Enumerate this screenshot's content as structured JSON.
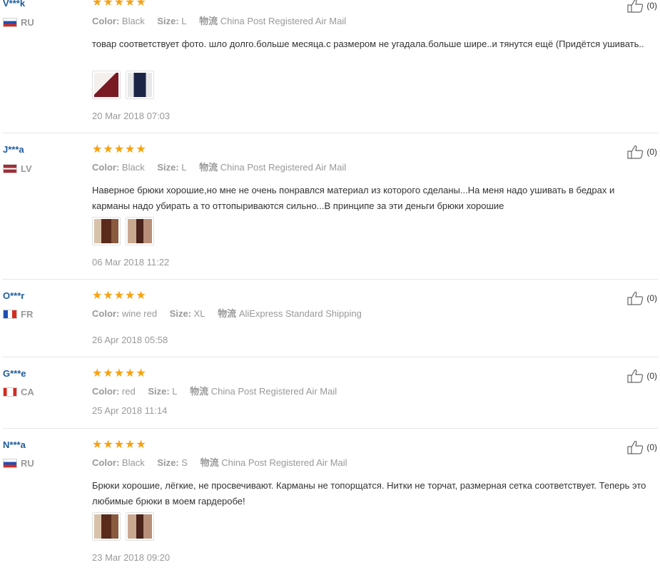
{
  "rating_star": "★★★★★",
  "thumb_colors": {
    "white_wine": [
      "#f3f0ee",
      "#7a1a22"
    ],
    "navy": [
      "#1c2545",
      "#2f3d72"
    ],
    "brown_a": [
      "#5a2a1d",
      "#d9c2aa"
    ],
    "brown_b": [
      "#4a231a",
      "#c9a890"
    ]
  },
  "reviews": [
    {
      "name": "V***k",
      "country": "RU",
      "flag": "ru",
      "color_label": "Color:",
      "color": "Black",
      "size_label": "Size:",
      "size": "L",
      "ship_label": "物流",
      "ship": "China Post Registered Air Mail",
      "text": "товар соответствует фото. шло долго.больше месяца.с размером не угадала.больше шире..и тянутся ещё (Придётся ушивать..",
      "date": "20 Mar 2018 07:03",
      "likes": "(0)"
    },
    {
      "name": "J***a",
      "country": "LV",
      "flag": "lv",
      "color_label": "Color:",
      "color": "Black",
      "size_label": "Size:",
      "size": "L",
      "ship_label": "物流",
      "ship": "China Post Registered Air Mail",
      "text": "Наверное брюки хорошие,но мне не очень понравлся материал из которого сделаны...На меня надо ушивать в бедрах и карманы надо убирать а то оттопыриваются сильно...В принципе за эти деньги брюки хорошие",
      "date": "06 Mar 2018 11:22",
      "likes": "(0)"
    },
    {
      "name": "O***r",
      "country": "FR",
      "flag": "fr",
      "color_label": "Color:",
      "color": "wine red",
      "size_label": "Size:",
      "size": "XL",
      "ship_label": "物流",
      "ship": "AliExpress Standard Shipping",
      "text": "",
      "date": "26 Apr 2018 05:58",
      "likes": "(0)"
    },
    {
      "name": "G***e",
      "country": "CA",
      "flag": "ca",
      "color_label": "Color:",
      "color": "red",
      "size_label": "Size:",
      "size": "L",
      "ship_label": "物流",
      "ship": "China Post Registered Air Mail",
      "text": "",
      "date": "25 Apr 2018 11:14",
      "likes": "(0)"
    },
    {
      "name": "N***a",
      "country": "RU",
      "flag": "ru",
      "color_label": "Color:",
      "color": "Black",
      "size_label": "Size:",
      "size": "S",
      "ship_label": "物流",
      "ship": "China Post Registered Air Mail",
      "text": "Брюки хорошие, лёгкие, не просвечивают. Карманы не топорщатся. Нитки не торчат, размерная сетка соответствует. Теперь это любимые брюки в моем гардеробе!",
      "date": "23 Mar 2018 09:20",
      "likes": "(0)"
    }
  ]
}
